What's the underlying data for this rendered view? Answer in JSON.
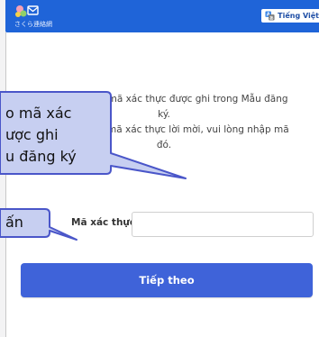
{
  "header": {
    "logo_text": "さくら連絡網",
    "language_button": "Tiếng Việt",
    "language_icon": "translate-icon"
  },
  "main": {
    "instruction_line1": "Vui lòng nhập mã xác thực được ghi trong Mẫu đăng",
    "instruction_line2": "ký.",
    "instruction_line3": "Nếu không có mã xác thực lời mời, vui lòng nhập mã",
    "instruction_line4": "đó.",
    "code_label": "Mã xác thực",
    "code_value": "",
    "next_button": "Tiếp theo"
  },
  "callouts": {
    "top_line1": "o mã xác",
    "top_line2": "ược ghi",
    "top_line3": "u đăng ký",
    "bottom_line1": "ấn"
  },
  "colors": {
    "header_bg": "#1f64d8",
    "button_bg": "#3f63d9",
    "callout_fill": "#c7cff1",
    "callout_stroke": "#4a56c9"
  }
}
